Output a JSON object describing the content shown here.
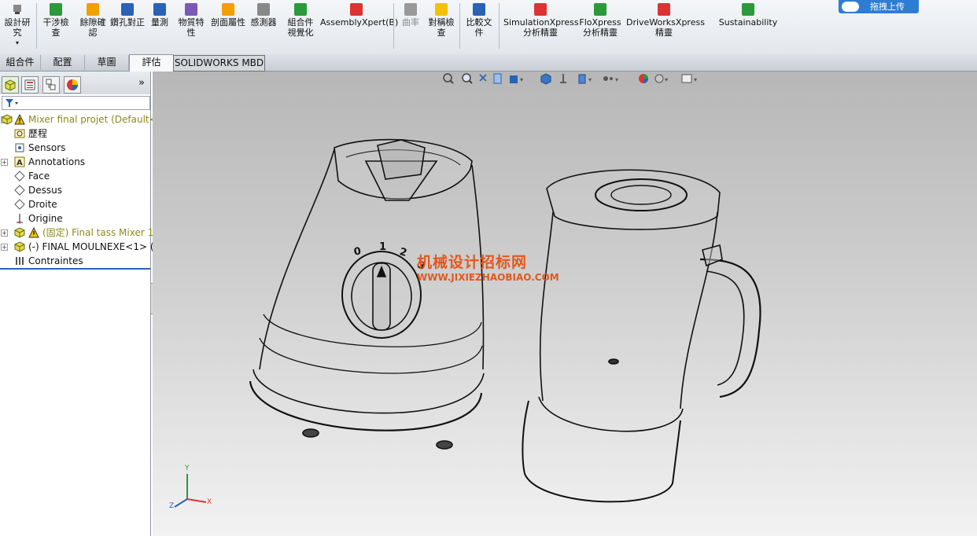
{
  "ribbon": {
    "design_study": "設計研究",
    "items": [
      {
        "label": "干涉檢查",
        "icon": "interference-icon"
      },
      {
        "label": "餘隙確認",
        "icon": "clearance-icon"
      },
      {
        "label": "鑽孔對正",
        "icon": "hole-alignment-icon"
      },
      {
        "label": "量測",
        "icon": "measure-icon"
      },
      {
        "label": "物質特性",
        "icon": "mass-properties-icon"
      },
      {
        "label": "剖面屬性",
        "icon": "section-properties-icon"
      },
      {
        "label": "感測器",
        "icon": "sensor-icon"
      },
      {
        "label": "組合件視覺化",
        "icon": "assembly-visualization-icon"
      },
      {
        "label": "AssemblyXpert(B)",
        "icon": "assemblyxpert-icon"
      },
      {
        "label": "曲率",
        "icon": "curvature-icon"
      },
      {
        "label": "對稱檢查",
        "icon": "symmetry-check-icon"
      },
      {
        "label": "比較文件",
        "icon": "compare-documents-icon"
      },
      {
        "label": "SimulationXpress分析精靈",
        "icon": "simulationxpress-icon"
      },
      {
        "label": "FloXpress分析精靈",
        "icon": "floxpress-icon"
      },
      {
        "label": "DriveWorksXpress精靈",
        "icon": "driveworksxpress-icon"
      },
      {
        "label": "Sustainability",
        "icon": "sustainability-icon"
      }
    ],
    "upload_label": "拖拽上传"
  },
  "tabs": [
    "組合件",
    "配置",
    "草圖",
    "評估",
    "SOLIDWORKS MBD"
  ],
  "active_tab": "評估",
  "tree": {
    "root": "Mixer final projet  (Default<",
    "items": [
      {
        "label": "歷程",
        "icon": "history-icon"
      },
      {
        "label": "Sensors",
        "icon": "sensors-icon"
      },
      {
        "label": "Annotations",
        "icon": "annotations-icon"
      },
      {
        "label": "Face",
        "icon": "plane-icon"
      },
      {
        "label": "Dessus",
        "icon": "plane-icon"
      },
      {
        "label": "Droite",
        "icon": "plane-icon"
      },
      {
        "label": "Origine",
        "icon": "origin-icon"
      },
      {
        "label": "(固定) Final tass Mixer 1<",
        "icon": "part-warning-icon"
      },
      {
        "label": "(-) FINAL MOULNEXE<1> (",
        "icon": "part-icon"
      },
      {
        "label": "Contraintes",
        "icon": "mates-icon"
      }
    ]
  },
  "viewport": {
    "watermark_cn": "机械设计招标网",
    "watermark_url": "WWW.JIXIEZHAOBIAO.COM",
    "dial_numbers": [
      "0",
      "1",
      "2",
      "3"
    ],
    "triad": {
      "x": "X",
      "y": "Y",
      "z": "Z"
    }
  },
  "colors": {
    "accent_blue": "#2a63b5",
    "warning_yellow": "#f2c200",
    "watermark_orange": "#e0591b"
  }
}
